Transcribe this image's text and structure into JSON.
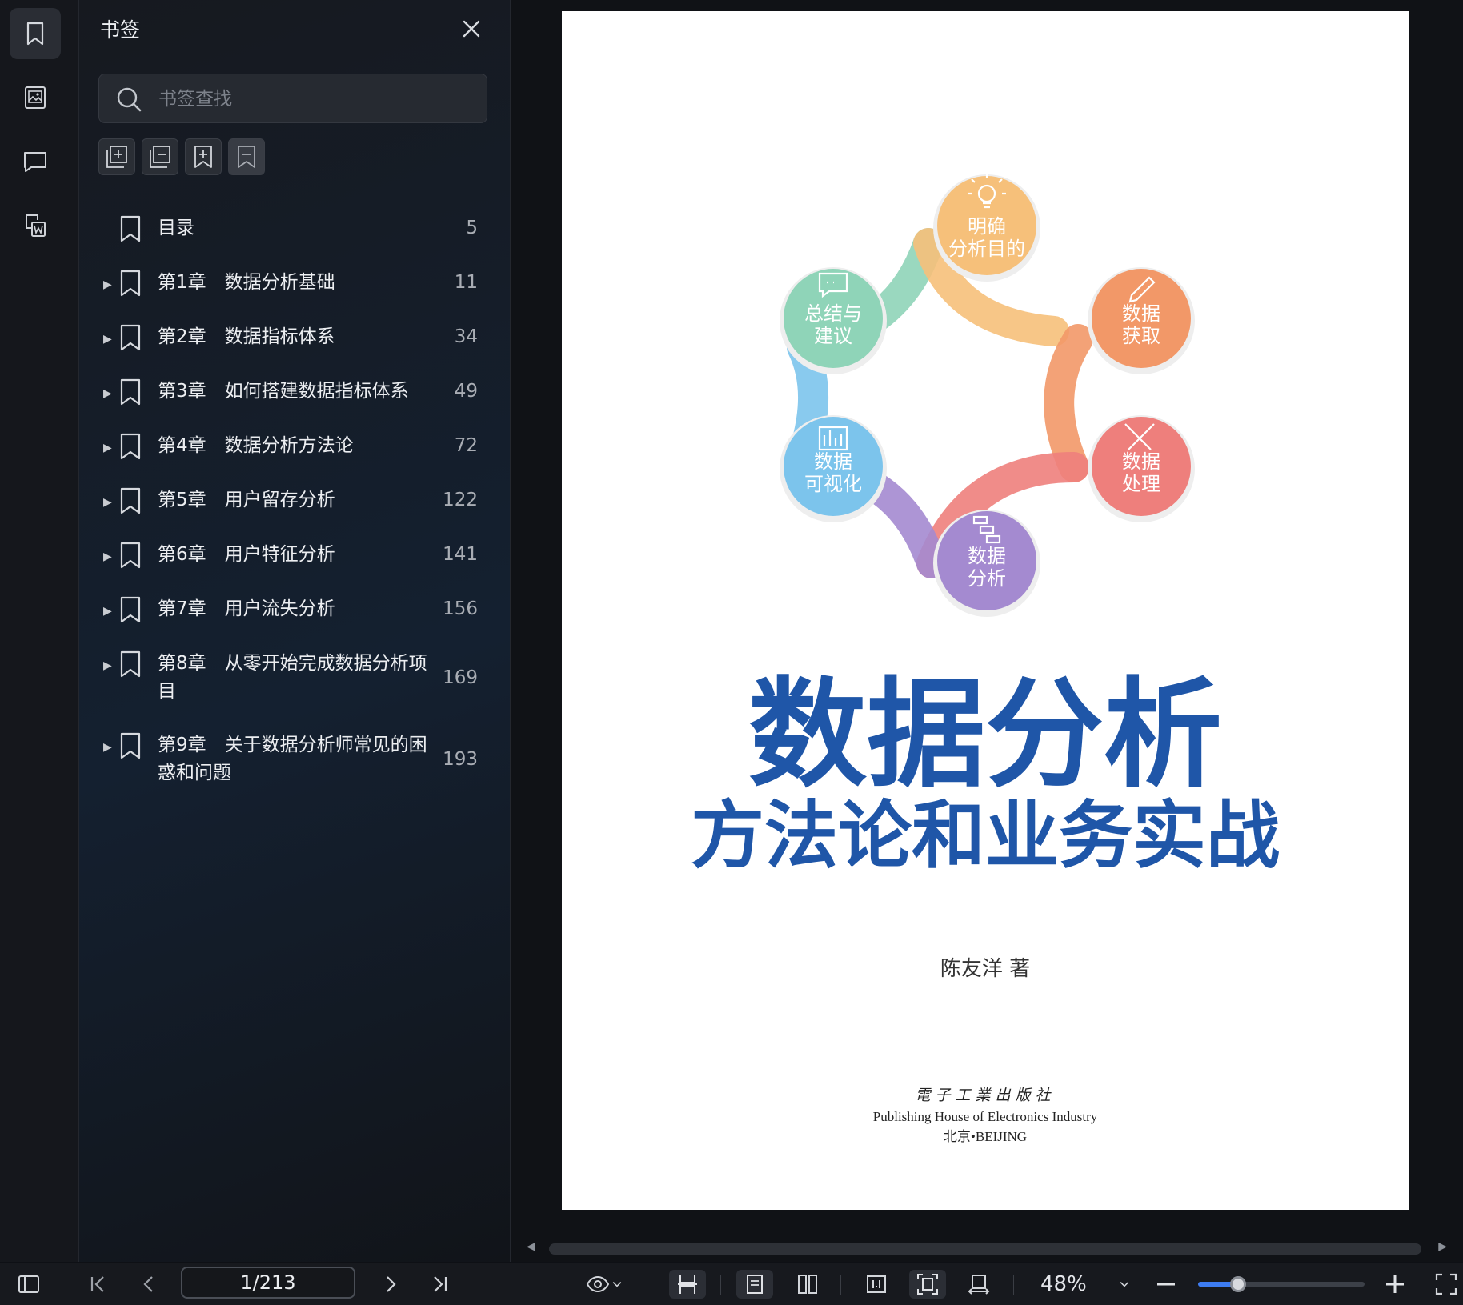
{
  "sidebar_panel": {
    "title": "书签",
    "search_placeholder": "书签查找",
    "bookmarks": [
      {
        "label": "目录",
        "page": "5",
        "expandable": false
      },
      {
        "label": "第1章　数据分析基础",
        "page": "11",
        "expandable": true
      },
      {
        "label": "第2章　数据指标体系",
        "page": "34",
        "expandable": true
      },
      {
        "label": "第3章　如何搭建数据指标体系",
        "page": "49",
        "expandable": true
      },
      {
        "label": "第4章　数据分析方法论",
        "page": "72",
        "expandable": true
      },
      {
        "label": "第5章　用户留存分析",
        "page": "122",
        "expandable": true
      },
      {
        "label": "第6章　用户特征分析",
        "page": "141",
        "expandable": true
      },
      {
        "label": "第7章　用户流失分析",
        "page": "156",
        "expandable": true
      },
      {
        "label": "第8章　从零开始完成数据分析项目",
        "page": "169",
        "expandable": true
      },
      {
        "label": "第9章　关于数据分析师常见的困惑和问题",
        "page": "193",
        "expandable": true
      }
    ]
  },
  "icons": {
    "rail": [
      "bookmark-icon",
      "thumbnail-icon",
      "comment-icon",
      "convert-word-icon"
    ],
    "panel_tools": [
      "expand-all-icon",
      "collapse-all-icon",
      "add-bookmark-icon",
      "remove-bookmark-icon"
    ]
  },
  "cover": {
    "cycle": [
      {
        "label": "明确\n分析目的",
        "color": "#f6c07a"
      },
      {
        "label": "数据\n获取",
        "color": "#f29868"
      },
      {
        "label": "数据\n处理",
        "color": "#ee7f7c"
      },
      {
        "label": "数据\n分析",
        "color": "#a48ad0"
      },
      {
        "label": "数据\n可视化",
        "color": "#7cc4ec"
      },
      {
        "label": "总结与\n建议",
        "color": "#8fd4b8"
      }
    ],
    "title_main": "数据分析",
    "title_sub": "方法论和业务实战",
    "author": "陈友洋 著",
    "publisher_cn": "電子工業出版社",
    "publisher_en": "Publishing House of Electronics Industry",
    "city": "北京•BEIJING",
    "title_color": "#1f56a8"
  },
  "bottom_bar": {
    "page_indicator": "1/213",
    "zoom": "48%",
    "zoom_fraction": 0.24
  }
}
